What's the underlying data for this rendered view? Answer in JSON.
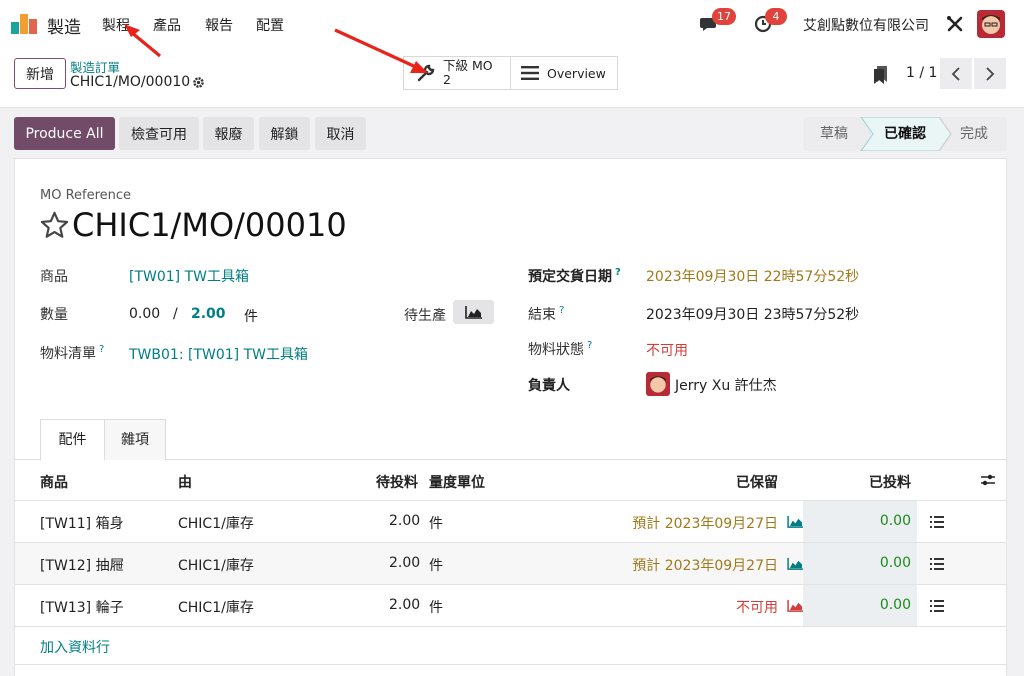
{
  "topbar": {
    "app_name": "製造",
    "nav": [
      "製程",
      "產品",
      "報告",
      "配置"
    ],
    "messages_count": "17",
    "activities_count": "4",
    "company": "艾創點數位有限公司"
  },
  "control": {
    "new_label": "新增",
    "breadcrumb_parent": "製造訂單",
    "breadcrumb_current": "CHIC1/MO/00010",
    "smart_child_label": "下級 MO",
    "smart_child_count": "2",
    "smart_overview_label": "Overview",
    "pager": "1 / 1"
  },
  "actions": [
    "Produce All",
    "檢查可用",
    "報廢",
    "解鎖",
    "取消"
  ],
  "statusbar": {
    "steps": [
      "草稿",
      "已確認",
      "完成"
    ],
    "active": "已確認"
  },
  "form": {
    "ref_label": "MO Reference",
    "ref_value": "CHIC1/MO/00010",
    "product_label": "商品",
    "product_value": "[TW01] TW工具箱",
    "qty_label": "數量",
    "qty_produced": "0.00",
    "qty_sep": "/",
    "qty_target": "2.00",
    "qty_uom": "件",
    "bom_label": "物料清單",
    "bom_value": "TWB01: [TW01] TW工具箱",
    "to_produce_label": "待生產",
    "deadline_label": "預定交貨日期",
    "deadline_value": "2023年09月30日 22時57分52秒",
    "end_label": "結束",
    "end_value": "2023年09月30日 23時57分52秒",
    "material_label": "物料狀態",
    "material_value": "不可用",
    "responsible_label": "負責人",
    "responsible_value": "Jerry Xu 許仕杰",
    "help": "?"
  },
  "tabs": [
    "配件",
    "雜項"
  ],
  "table": {
    "headers": [
      "商品",
      "由",
      "待投料",
      "量度單位",
      "已保留",
      "已投料"
    ],
    "rows": [
      {
        "product": "[TW11] 箱身",
        "from": "CHIC1/庫存",
        "qty": "2.00",
        "uom": "件",
        "reserved": "預計 2023年09月27日",
        "reserved_state": "forecast",
        "consumed": "0.00"
      },
      {
        "product": "[TW12] 抽屜",
        "from": "CHIC1/庫存",
        "qty": "2.00",
        "uom": "件",
        "reserved": "預計 2023年09月27日",
        "reserved_state": "forecast",
        "consumed": "0.00"
      },
      {
        "product": "[TW13] 輪子",
        "from": "CHIC1/庫存",
        "qty": "2.00",
        "uom": "件",
        "reserved": "不可用",
        "reserved_state": "unavailable",
        "consumed": "0.00"
      }
    ],
    "add_line": "加入資料行"
  },
  "colors": {
    "brand": "#714b67",
    "link": "#017e84",
    "forecast": "#a0791a",
    "danger": "#d23f3a",
    "success": "#1c8a1c"
  }
}
